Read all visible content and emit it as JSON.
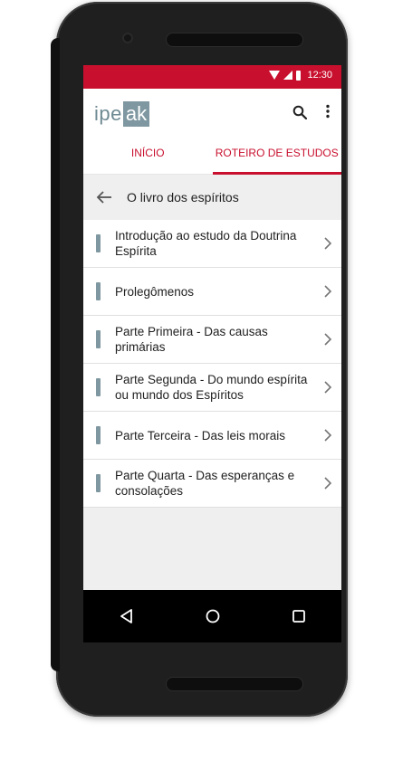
{
  "status": {
    "time": "12:30"
  },
  "appbar": {
    "logo_part1": "ipe",
    "logo_part2": "ak",
    "icons": [
      "search-icon",
      "more-vert-icon"
    ]
  },
  "tabs": [
    {
      "label": "INÍCIO",
      "active": false
    },
    {
      "label": "ROTEIRO DE ESTUDOS",
      "active": true
    }
  ],
  "section": {
    "title": "O livro dos espíritos"
  },
  "items": [
    {
      "label": "Introdução ao estudo da Doutrina Espírita"
    },
    {
      "label": "Prolegômenos"
    },
    {
      "label": "Parte Primeira - Das causas primárias"
    },
    {
      "label": "Parte Segunda - Do mundo espírita ou mundo dos Espíritos"
    },
    {
      "label": "Parte Terceira - Das leis morais"
    },
    {
      "label": "Parte Quarta - Das esperanças e consolações"
    }
  ],
  "colors": {
    "accent": "#c8102e",
    "icon": "#7e97a0",
    "background": "#efefef"
  }
}
